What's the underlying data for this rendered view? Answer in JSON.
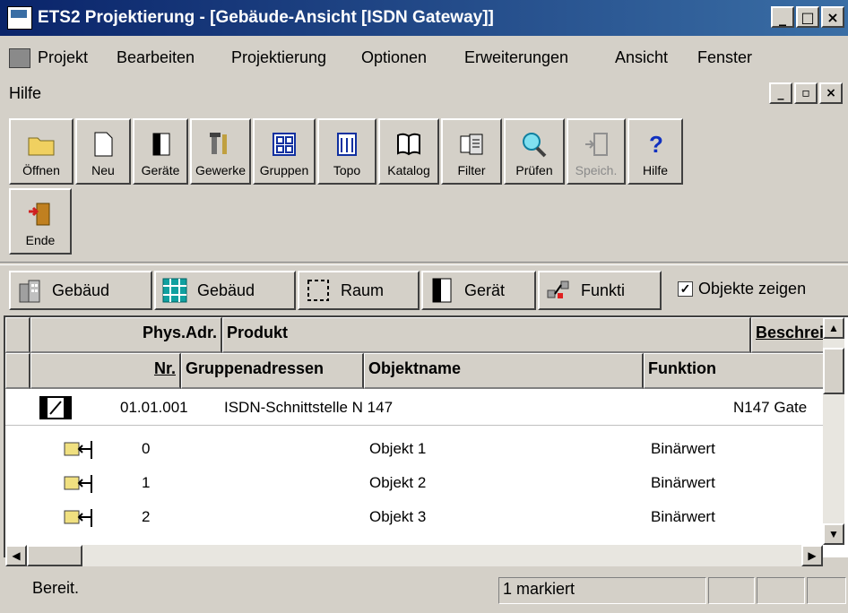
{
  "window": {
    "title": "ETS2 Projektierung - [Gebäude-Ansicht [ISDN Gateway]]",
    "controls": [
      "_",
      "□",
      "×"
    ]
  },
  "menubar": {
    "items": [
      "Projekt",
      "Bearbeiten",
      "Projektierung",
      "Optionen",
      "Erweiterungen",
      "Ansicht",
      "Fenster"
    ],
    "second_row": "Hilfe",
    "mdi_controls": [
      "_",
      "▫",
      "×"
    ]
  },
  "toolbar": {
    "buttons": [
      {
        "label": "Öffnen",
        "icon": "folder-icon"
      },
      {
        "label": "Neu",
        "icon": "new-document-icon"
      },
      {
        "label": "Geräte",
        "icon": "device-icon"
      },
      {
        "label": "Gewerke",
        "icon": "tools-icon"
      },
      {
        "label": "Gruppen",
        "icon": "groups-icon"
      },
      {
        "label": "Topo",
        "icon": "topology-icon"
      },
      {
        "label": "Katalog",
        "icon": "catalog-book-icon"
      },
      {
        "label": "Filter",
        "icon": "filter-icon"
      },
      {
        "label": "Prüfen",
        "icon": "magnifier-icon"
      },
      {
        "label": "Speich.",
        "icon": "save-icon",
        "disabled": true
      },
      {
        "label": "Hilfe",
        "icon": "help-question-icon"
      },
      {
        "label": "Ende",
        "icon": "exit-door-icon"
      }
    ]
  },
  "viewbar": {
    "buttons": [
      {
        "label": "Gebäud",
        "icon": "building-icon"
      },
      {
        "label": "Gebäud",
        "icon": "building-parts-icon"
      },
      {
        "label": "Raum",
        "icon": "room-icon"
      },
      {
        "label": "Gerät",
        "icon": "device-icon"
      },
      {
        "label": "Funkti",
        "icon": "function-icon"
      }
    ],
    "checkbox_label": "Objekte zeigen",
    "checkbox_checked": true
  },
  "grid": {
    "header1": [
      "Phys.Adr.",
      "Produkt",
      "Beschreil"
    ],
    "header2": [
      "Nr.",
      "Gruppenadressen",
      "Objektname",
      "Funktion"
    ],
    "device_row": {
      "address": "01.01.001",
      "product": "ISDN-Schnittstelle N 147",
      "description": "N147 Gate"
    },
    "object_rows": [
      {
        "nr": "0",
        "name": "Objekt 1",
        "function": "Binärwert"
      },
      {
        "nr": "1",
        "name": "Objekt 2",
        "function": "Binärwert"
      },
      {
        "nr": "2",
        "name": "Objekt 3",
        "function": "Binärwert"
      }
    ]
  },
  "statusbar": {
    "text": "Bereit.",
    "selection": "1 markiert"
  }
}
